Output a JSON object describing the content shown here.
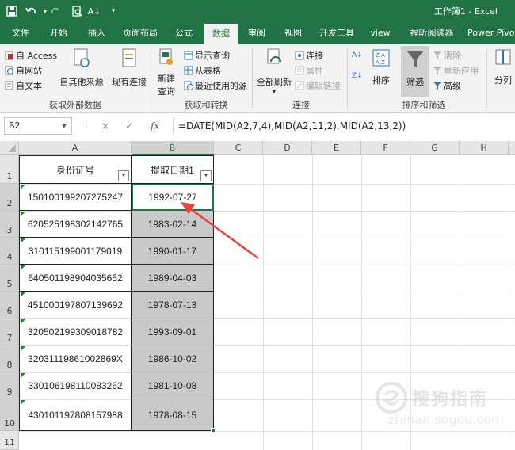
{
  "titlebar": {
    "title": "工作簿1  -  Excel",
    "quick_access": [
      "save-icon",
      "undo-icon",
      "redo-icon",
      "print-preview-icon",
      "sort-icon",
      "customize-icon"
    ]
  },
  "tabs": [
    "文件",
    "开始",
    "插入",
    "页面布局",
    "公式",
    "数据",
    "审阅",
    "视图",
    "开发工具",
    "view",
    "福昕阅读器",
    "Power Pivot"
  ],
  "active_tab": "数据",
  "ribbon": {
    "get_external": {
      "access": "自 Access",
      "web": "自网站",
      "text": "自文本",
      "other_sources": "自其他来源",
      "existing": "现有连接",
      "label": "获取外部数据"
    },
    "get_transform": {
      "new_query_1": "新建",
      "new_query_2": "查询",
      "show_queries": "显示查询",
      "from_table": "从表格",
      "recent_sources": "最近使用的源",
      "label": "获取和转换"
    },
    "connections": {
      "refresh_all": "全部刷新",
      "connections": "连接",
      "properties": "属性",
      "edit_links": "编辑链接",
      "label": "连接"
    },
    "sort_filter": {
      "sort": "排序",
      "filter": "筛选",
      "clear": "清除",
      "reapply": "重新应用",
      "advanced": "高级",
      "label": "排序和筛选"
    },
    "data_tools": {
      "split": "分列"
    }
  },
  "formula_bar": {
    "name_box": "B2",
    "formula": "=DATE(MID(A2,7,4),MID(A2,11,2),MID(A2,13,2))",
    "cancel_glyph": "×",
    "enter_glyph": "✓",
    "fx_label": "fx"
  },
  "columns": [
    "A",
    "B",
    "C",
    "D",
    "E",
    "F",
    "G",
    "H"
  ],
  "rows": [
    "1",
    "2",
    "3",
    "4",
    "5",
    "6",
    "7",
    "8",
    "9",
    "10",
    "11"
  ],
  "table": {
    "headers": [
      "身份证号",
      "提取日期1"
    ],
    "rows": [
      [
        "150100199207275247",
        "1992-07-27"
      ],
      [
        "620525198302142765",
        "1983-02-14"
      ],
      [
        "310115199001179019",
        "1990-01-17"
      ],
      [
        "640501198904035652",
        "1989-04-03"
      ],
      [
        "451000197807139692",
        "1978-07-13"
      ],
      [
        "320502199309018782",
        "1993-09-01"
      ],
      [
        "32031119861002869X",
        "1986-10-02"
      ],
      [
        "330106198110083262",
        "1981-10-08"
      ],
      [
        "430101197808157988",
        "1978-08-15"
      ]
    ]
  },
  "annotation": {
    "color": "#e8413c"
  },
  "watermark": {
    "cn": "搜狗指南",
    "en": "zhinan.sogou.com"
  },
  "colors": {
    "excel_green": "#217346",
    "selection_fill": "#c9c9c9"
  }
}
